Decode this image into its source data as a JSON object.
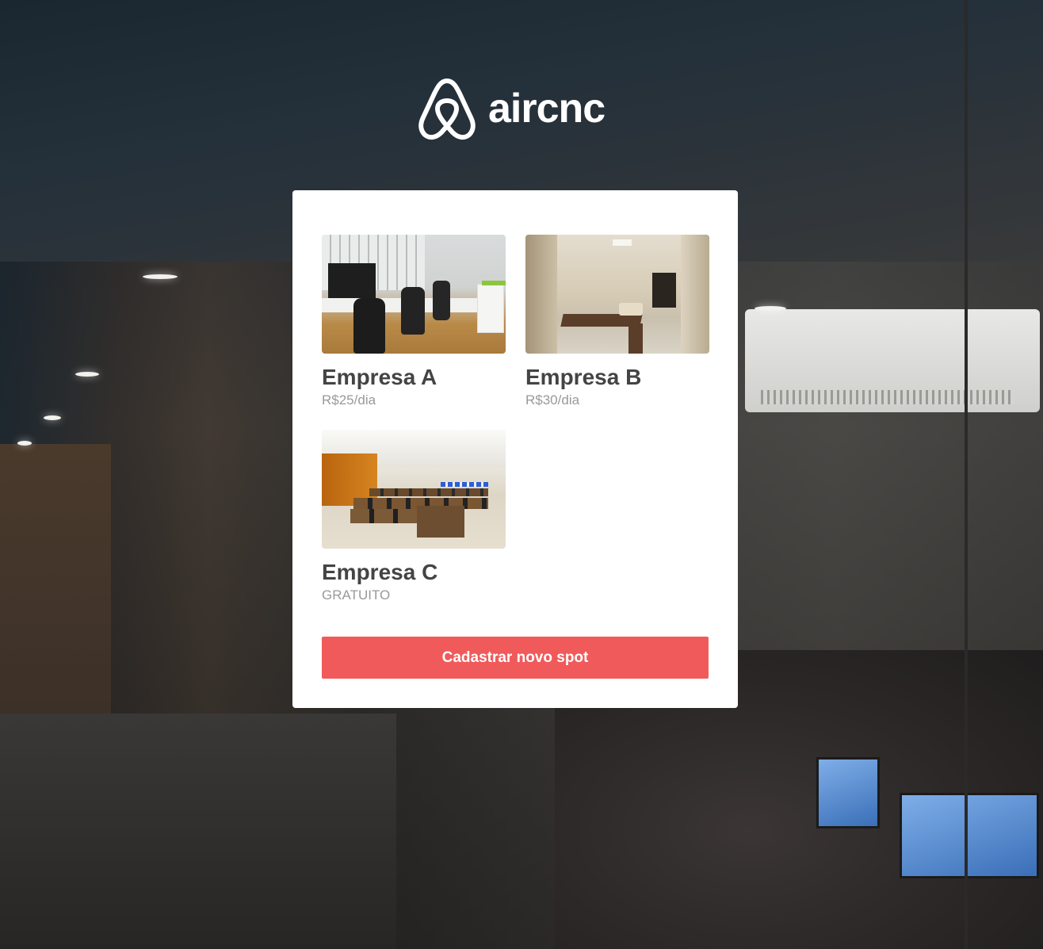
{
  "app": {
    "brand": "aircnc"
  },
  "spots": [
    {
      "title": "Empresa A",
      "price": "R$25/dia"
    },
    {
      "title": "Empresa B",
      "price": "R$30/dia"
    },
    {
      "title": "Empresa C",
      "price": "GRATUITO"
    }
  ],
  "actions": {
    "new_spot_label": "Cadastrar novo spot"
  },
  "colors": {
    "accent": "#f05a5b",
    "card_bg": "#ffffff",
    "title_text": "#444444",
    "price_text": "#999999"
  }
}
